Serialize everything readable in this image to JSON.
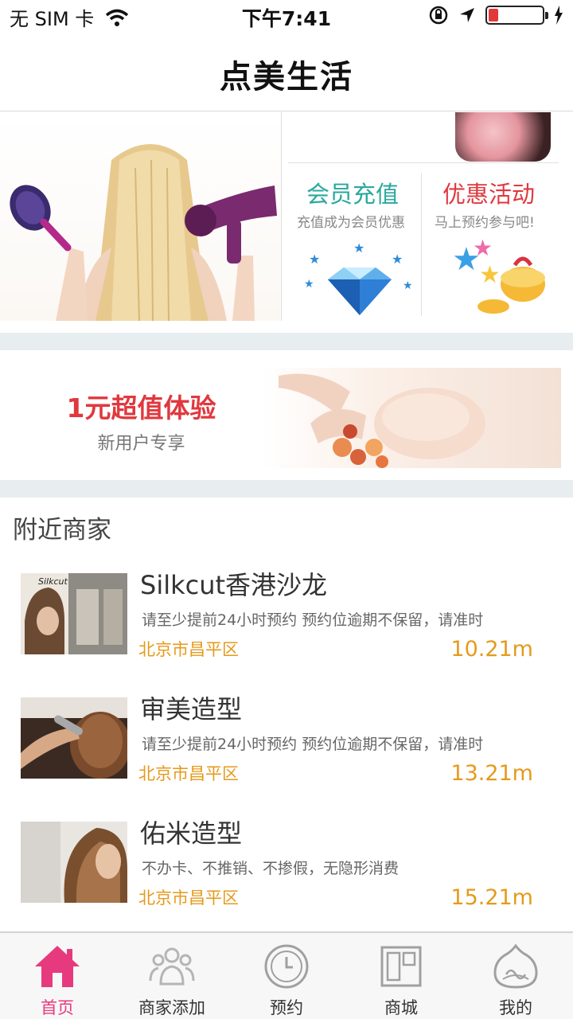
{
  "status_bar": {
    "carrier": "无 SIM 卡",
    "time": "下午7:41",
    "battery_level": 0.18
  },
  "nav": {
    "title": "点美生活"
  },
  "promos": {
    "member": {
      "title": "会员充值",
      "subtitle": "充值成为会员优惠",
      "color": "#2aa89c"
    },
    "discount": {
      "title": "优惠活动",
      "subtitle": "马上预约参与吧!",
      "color": "#e0383e"
    }
  },
  "experience": {
    "title": "1元超值体验",
    "subtitle": "新用户专享"
  },
  "nearby": {
    "title": "附近商家",
    "shops": [
      {
        "name": "Silkcut香港沙龙",
        "desc": "请至少提前24小时预约   预约位逾期不保留，请准时",
        "address": "北京市昌平区",
        "distance": "10.21m",
        "logo_text": "Silkcut"
      },
      {
        "name": "审美造型",
        "desc": "请至少提前24小时预约   预约位逾期不保留，请准时",
        "address": "北京市昌平区",
        "distance": "13.21m"
      },
      {
        "name": "佑米造型",
        "desc": "不办卡、不推销、不掺假，无隐形消费",
        "address": "北京市昌平区",
        "distance": "15.21m"
      }
    ]
  },
  "tabbar": {
    "accent_color": "#e73a7e",
    "items": [
      {
        "label": "首页",
        "icon": "home-icon",
        "active": true
      },
      {
        "label": "商家添加",
        "icon": "group-icon",
        "active": false
      },
      {
        "label": "预约",
        "icon": "clock-icon",
        "active": false
      },
      {
        "label": "商城",
        "icon": "store-icon",
        "active": false
      },
      {
        "label": "我的",
        "icon": "profile-icon",
        "active": false
      }
    ]
  }
}
